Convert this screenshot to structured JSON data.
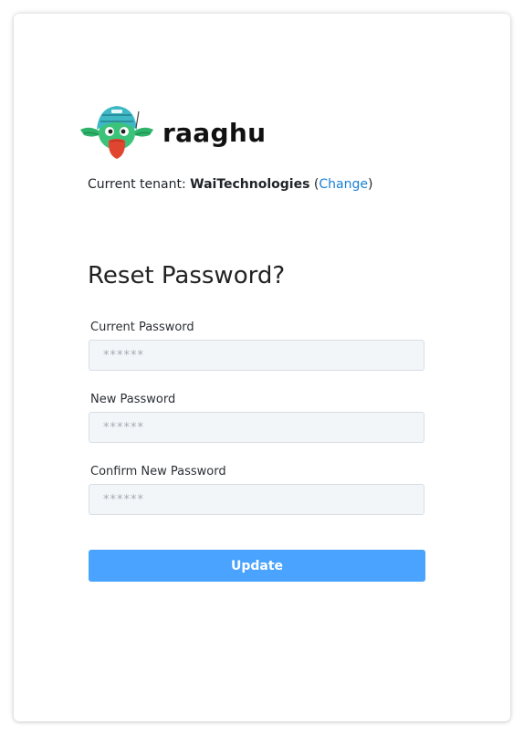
{
  "brand": {
    "name": "raaghu",
    "logo_icon": "parrot-mascot-icon"
  },
  "tenant": {
    "prefix": "Current tenant: ",
    "name": "WaiTechnologies",
    "open_paren": " (",
    "change_link": "Change",
    "close_paren": ")"
  },
  "form": {
    "title": "Reset Password?",
    "current_password": {
      "label": "Current Password",
      "placeholder": "******",
      "value": ""
    },
    "new_password": {
      "label": "New Password",
      "placeholder": "******",
      "value": ""
    },
    "confirm_password": {
      "label": "Confirm New Password",
      "placeholder": "******",
      "value": ""
    },
    "submit_label": "Update"
  },
  "colors": {
    "accent": "#4aa3ff",
    "link": "#1a7fd6",
    "input_bg": "#f3f6f9"
  }
}
